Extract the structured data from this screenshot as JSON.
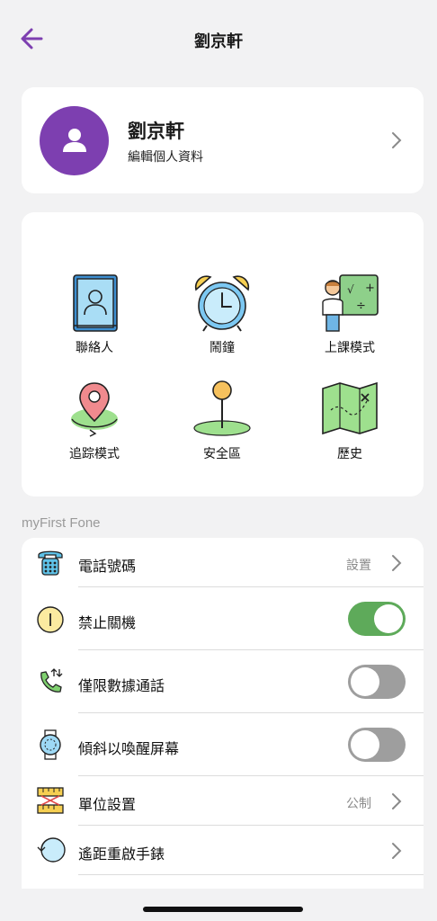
{
  "nav": {
    "title": "劉京軒",
    "back_icon": "arrow-left-icon",
    "accent": "#7d3fb0"
  },
  "profile": {
    "name": "劉京軒",
    "edit_label": "編輯個人資料",
    "avatar_icon": "person-icon",
    "avatar_color": "#7d3fb0"
  },
  "features": [
    {
      "label": "聯絡人",
      "icon": "contacts-book-icon"
    },
    {
      "label": "鬧鐘",
      "icon": "alarm-clock-icon"
    },
    {
      "label": "上課模式",
      "icon": "class-mode-icon"
    },
    {
      "label": "追踪模式",
      "icon": "tracking-pin-icon"
    },
    {
      "label": "安全區",
      "icon": "safe-zone-icon"
    },
    {
      "label": "歷史",
      "icon": "history-map-icon"
    }
  ],
  "section_label": "myFirst Fone",
  "settings": [
    {
      "label": "電話號碼",
      "value": "設置",
      "icon": "phone-icon"
    },
    {
      "label": "禁止關機",
      "toggle": true,
      "icon": "power-icon"
    },
    {
      "label": "僅限數據通話",
      "toggle": false,
      "icon": "data-call-icon"
    },
    {
      "label": "傾斜以喚醒屏幕",
      "toggle": false,
      "icon": "watch-icon"
    },
    {
      "label": "單位設置",
      "value": "公制",
      "icon": "ruler-icon"
    },
    {
      "label": "遙距重啟手錶",
      "icon": "restart-icon"
    }
  ],
  "colors": {
    "toggle_on": "#5eaa5a",
    "toggle_off": "#9e9e9e",
    "background": "#f2f2f3"
  }
}
